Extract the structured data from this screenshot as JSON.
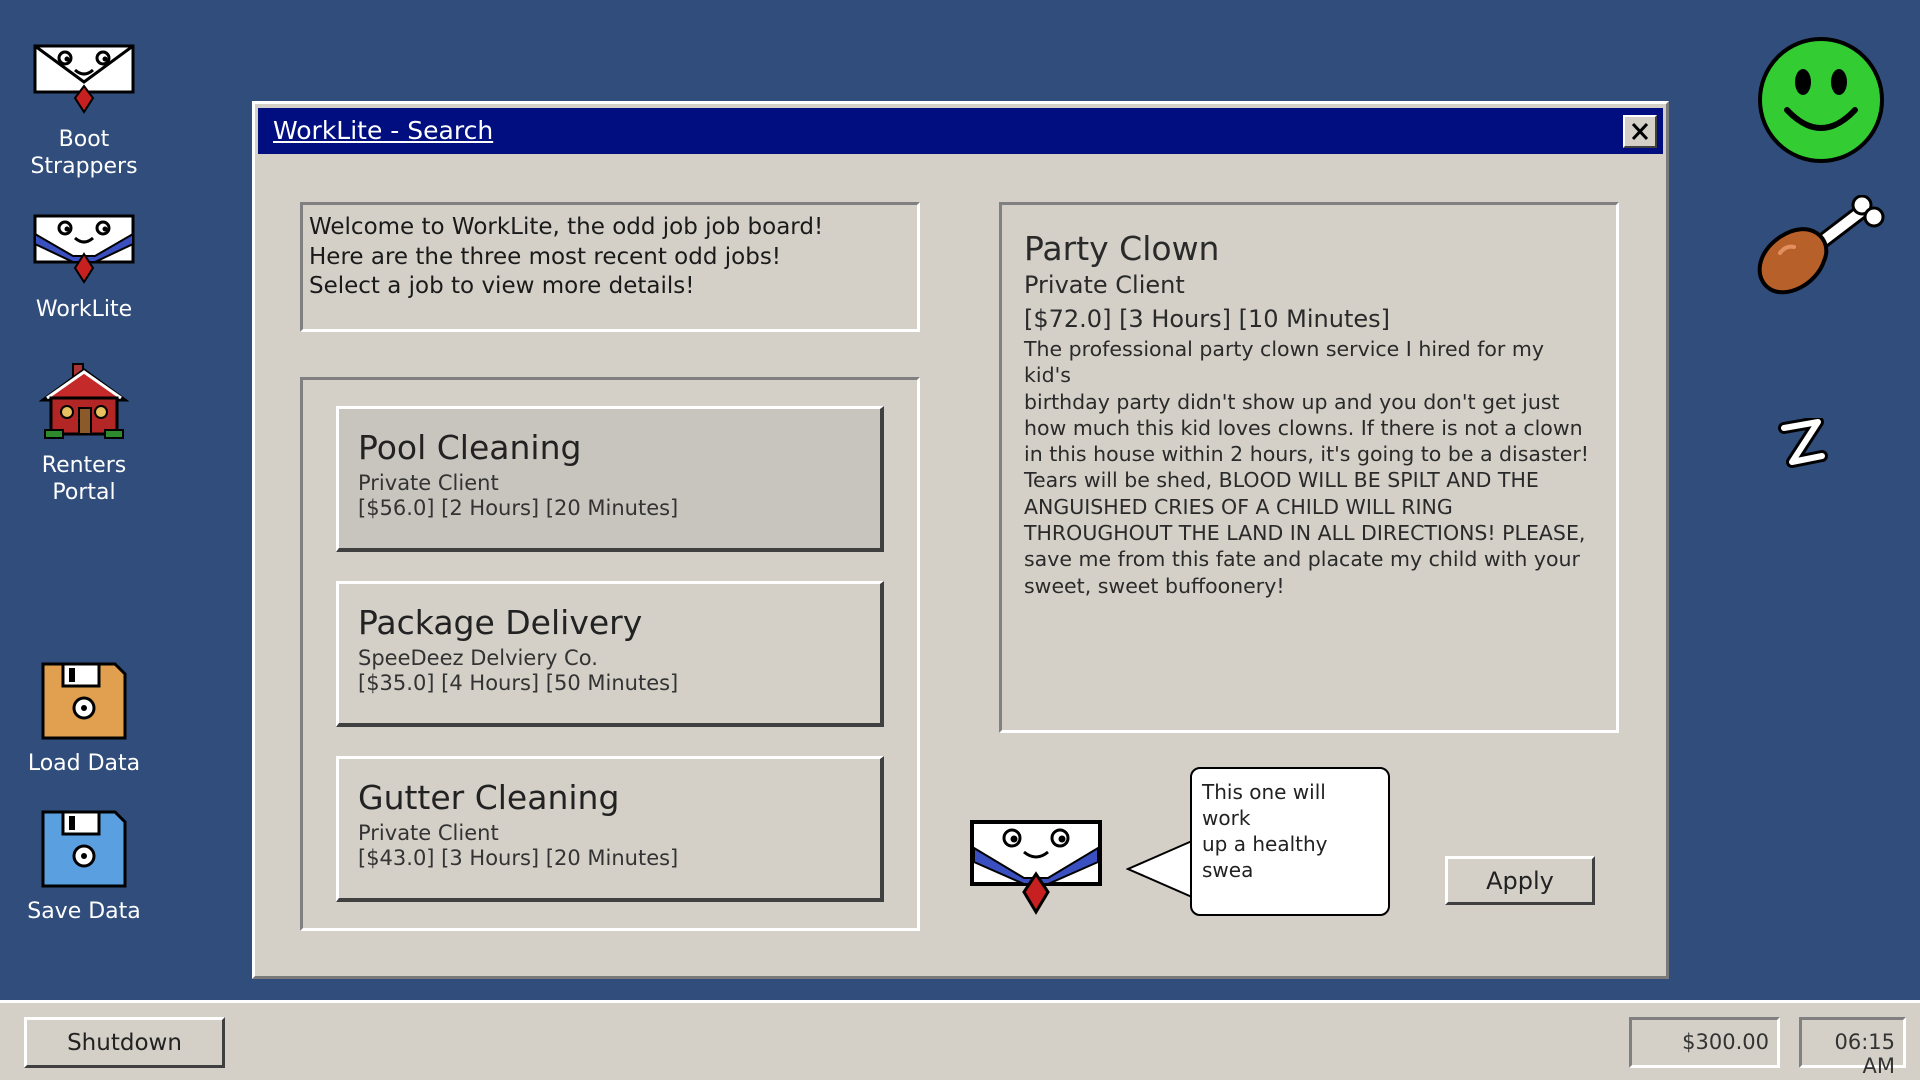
{
  "desktop": {
    "icons": [
      {
        "label": "Boot\nStrappers",
        "icon": "boot-strappers-icon"
      },
      {
        "label": "WorkLite",
        "icon": "worklite-icon"
      },
      {
        "label": "Renters\nPortal",
        "icon": "house-icon"
      },
      {
        "label": "Load Data",
        "icon": "floppy-orange-icon"
      },
      {
        "label": "Save Data",
        "icon": "floppy-blue-icon"
      }
    ],
    "side_icons": [
      "smiley-face-icon",
      "drumstick-icon",
      "sleep-z-icon"
    ],
    "background_color": "#304d7c"
  },
  "window": {
    "title": "WorkLite - Search",
    "titlebar_color": "#000e80",
    "welcome_lines": [
      "Welcome to WorkLite, the odd job job board!",
      "Here are the three most recent odd jobs!",
      "Select a job to view more details!"
    ],
    "jobs": [
      {
        "title": "Pool Cleaning",
        "client": "Private Client",
        "info": "[$56.0] [2 Hours] [20 Minutes]"
      },
      {
        "title": "Package Delivery",
        "client": "SpeeDeez Delviery Co.",
        "info": "[$35.0] [4 Hours] [50 Minutes]"
      },
      {
        "title": "Gutter Cleaning",
        "client": "Private Client",
        "info": "[$43.0] [3 Hours] [20 Minutes]"
      }
    ],
    "detail": {
      "title": "Party Clown",
      "client": "Private Client",
      "info": "[$72.0] [3 Hours] [10 Minutes]",
      "description_lines": [
        "The professional party clown service I hired for my kid's",
        "birthday party didn't show up and you don't get just",
        "how much this kid loves clowns. If there is not a clown",
        "in this house within 2 hours, it's going to be a disaster!",
        "Tears will be shed, BLOOD WILL BE SPILT AND THE",
        "ANGUISHED CRIES OF A CHILD WILL RING",
        "THROUGHOUT THE LAND IN ALL DIRECTIONS! PLEASE,",
        "save me from this fate and placate my child with your",
        "sweet, sweet buffoonery!"
      ]
    },
    "bubble_lines": [
      "This one will work",
      "up a healthy",
      "swea"
    ],
    "apply_label": "Apply"
  },
  "taskbar": {
    "shutdown_label": "Shutdown",
    "money": "$300.00",
    "time": "06:15 AM"
  }
}
